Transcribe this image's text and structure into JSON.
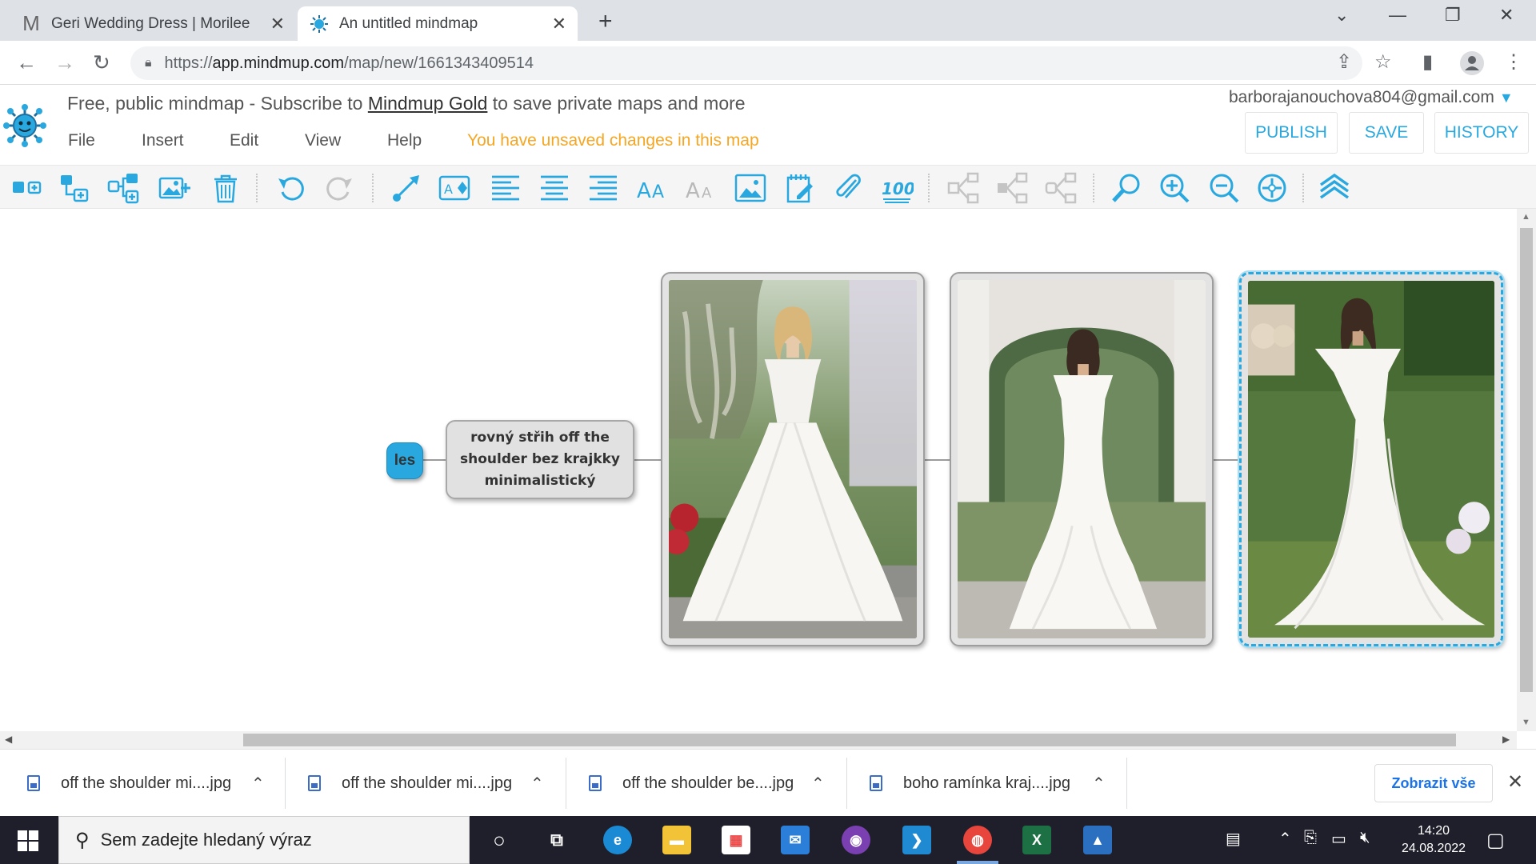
{
  "browser": {
    "tabs": [
      {
        "title": "Geri Wedding Dress | Morilee",
        "favicon": "M",
        "active": false
      },
      {
        "title": "An untitled mindmap",
        "favicon": "mindmup-icon",
        "active": true
      }
    ],
    "new_tab": "+",
    "window_controls": {
      "tab_search": "⌄",
      "minimize": "—",
      "restore": "❐",
      "close": "✕"
    },
    "url_prefix": "https://",
    "url_host": "app.mindmup.com",
    "url_path": "/map/new/1661343409514"
  },
  "mindmup": {
    "tagline_before": "Free, public mindmap - Subscribe to ",
    "tagline_link": "Mindmup Gold",
    "tagline_after": " to save private maps and more",
    "menu": [
      "File",
      "Insert",
      "Edit",
      "View",
      "Help"
    ],
    "unsaved_notice": "You have unsaved changes in this map",
    "account_email": "barborajanouchova804@gmail.com",
    "buttons": {
      "publish": "PUBLISH",
      "save": "SAVE",
      "history": "HISTORY"
    },
    "accent_color": "#29a8e0",
    "unsaved_color": "#f5a623"
  },
  "map": {
    "root_label": "les",
    "child_label": "rovný střih off the shoulder bez krajkky minimalistický",
    "image_nodes": [
      {
        "name": "dress-ballgown",
        "selected": false
      },
      {
        "name": "dress-mermaid-arch",
        "selected": false
      },
      {
        "name": "dress-mermaid-garden",
        "selected": true
      }
    ]
  },
  "downloads": {
    "items": [
      "off the shoulder mi....jpg",
      "off the shoulder mi....jpg",
      "off the shoulder be....jpg",
      "boho ramínka kraj....jpg"
    ],
    "show_all": "Zobrazit vše"
  },
  "taskbar": {
    "search_placeholder": "Sem zadejte hledaný výraz",
    "time": "14:20",
    "date": "24.08.2022",
    "apps": [
      "cortana-icon",
      "task-view-icon",
      "edge-icon",
      "file-explorer-icon",
      "microsoft-store-icon",
      "mail-icon",
      "github-desktop-icon",
      "vscode-icon",
      "chrome-icon",
      "excel-icon",
      "photos-icon"
    ]
  }
}
